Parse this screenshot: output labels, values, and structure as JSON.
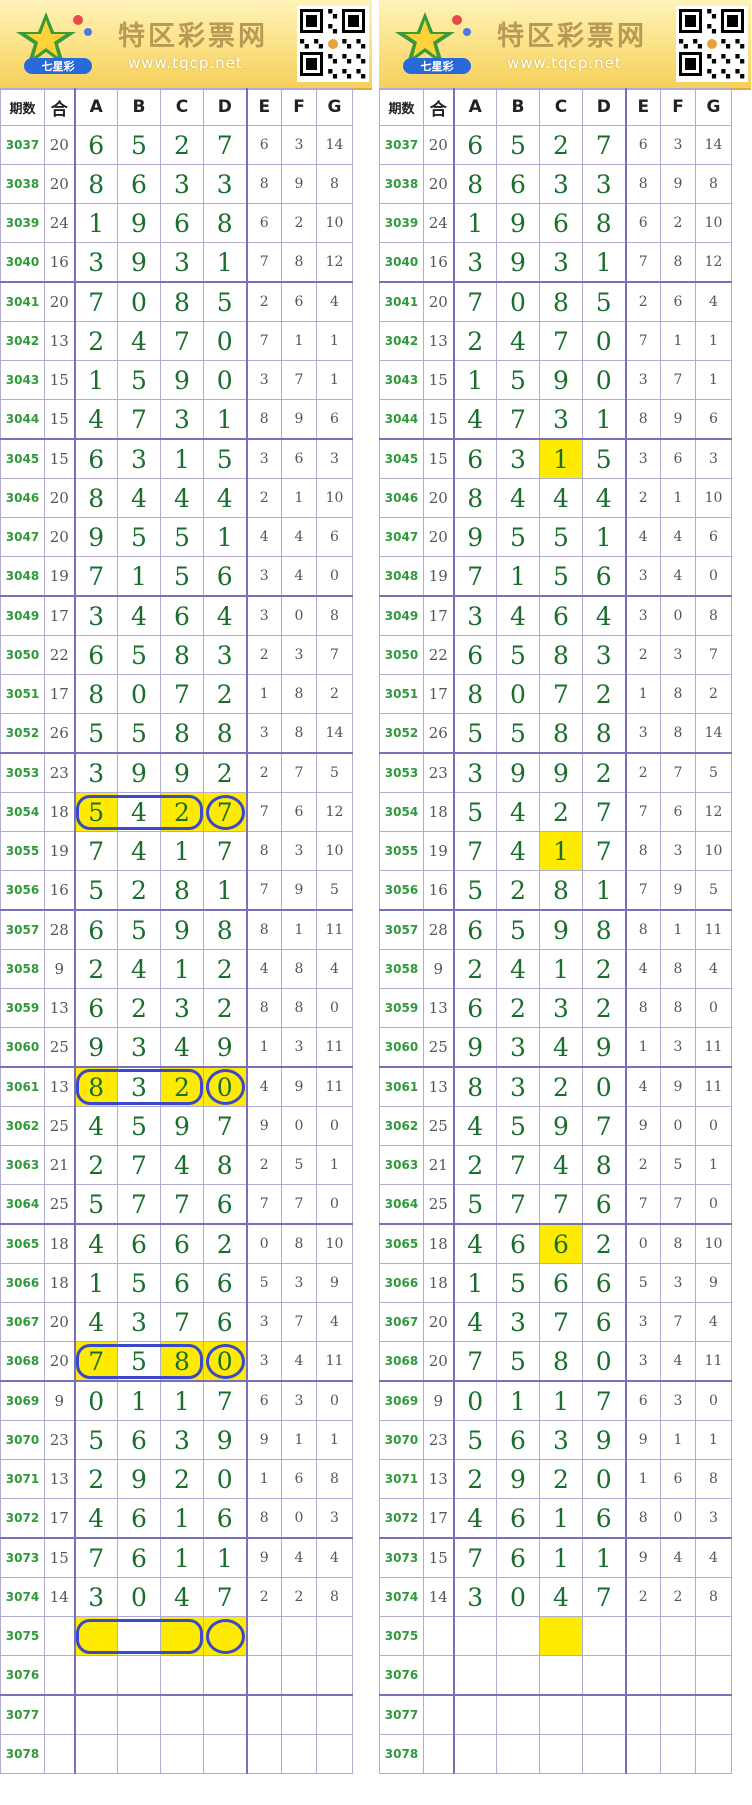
{
  "site": {
    "name": "特区彩票网",
    "url": "www.tqcp.net",
    "logo_text": "七星彩",
    "colors": {
      "header": "#f6cf5a",
      "digit": "#1a6e2c",
      "issue": "#2e9a3a",
      "highlight": "#ffeb00",
      "circle": "#3a48cc"
    }
  },
  "headers": [
    "期数",
    "合",
    "A",
    "B",
    "C",
    "D",
    "E",
    "F",
    "G"
  ],
  "rows": [
    {
      "q": "3037",
      "sum": "20",
      "a": "6",
      "b": "5",
      "c": "2",
      "d": "7",
      "e": "6",
      "f": "3",
      "g": "14"
    },
    {
      "q": "3038",
      "sum": "20",
      "a": "8",
      "b": "6",
      "c": "3",
      "d": "3",
      "e": "8",
      "f": "9",
      "g": "8"
    },
    {
      "q": "3039",
      "sum": "24",
      "a": "1",
      "b": "9",
      "c": "6",
      "d": "8",
      "e": "6",
      "f": "2",
      "g": "10"
    },
    {
      "q": "3040",
      "sum": "16",
      "a": "3",
      "b": "9",
      "c": "3",
      "d": "1",
      "e": "7",
      "f": "8",
      "g": "12"
    },
    {
      "q": "3041",
      "sum": "20",
      "a": "7",
      "b": "0",
      "c": "8",
      "d": "5",
      "e": "2",
      "f": "6",
      "g": "4"
    },
    {
      "q": "3042",
      "sum": "13",
      "a": "2",
      "b": "4",
      "c": "7",
      "d": "0",
      "e": "7",
      "f": "1",
      "g": "1"
    },
    {
      "q": "3043",
      "sum": "15",
      "a": "1",
      "b": "5",
      "c": "9",
      "d": "0",
      "e": "3",
      "f": "7",
      "g": "1"
    },
    {
      "q": "3044",
      "sum": "15",
      "a": "4",
      "b": "7",
      "c": "3",
      "d": "1",
      "e": "8",
      "f": "9",
      "g": "6"
    },
    {
      "q": "3045",
      "sum": "15",
      "a": "6",
      "b": "3",
      "c": "1",
      "d": "5",
      "e": "3",
      "f": "6",
      "g": "3"
    },
    {
      "q": "3046",
      "sum": "20",
      "a": "8",
      "b": "4",
      "c": "4",
      "d": "4",
      "e": "2",
      "f": "1",
      "g": "10"
    },
    {
      "q": "3047",
      "sum": "20",
      "a": "9",
      "b": "5",
      "c": "5",
      "d": "1",
      "e": "4",
      "f": "4",
      "g": "6"
    },
    {
      "q": "3048",
      "sum": "19",
      "a": "7",
      "b": "1",
      "c": "5",
      "d": "6",
      "e": "3",
      "f": "4",
      "g": "0"
    },
    {
      "q": "3049",
      "sum": "17",
      "a": "3",
      "b": "4",
      "c": "6",
      "d": "4",
      "e": "3",
      "f": "0",
      "g": "8"
    },
    {
      "q": "3050",
      "sum": "22",
      "a": "6",
      "b": "5",
      "c": "8",
      "d": "3",
      "e": "2",
      "f": "3",
      "g": "7"
    },
    {
      "q": "3051",
      "sum": "17",
      "a": "8",
      "b": "0",
      "c": "7",
      "d": "2",
      "e": "1",
      "f": "8",
      "g": "2"
    },
    {
      "q": "3052",
      "sum": "26",
      "a": "5",
      "b": "5",
      "c": "8",
      "d": "8",
      "e": "3",
      "f": "8",
      "g": "14"
    },
    {
      "q": "3053",
      "sum": "23",
      "a": "3",
      "b": "9",
      "c": "9",
      "d": "2",
      "e": "2",
      "f": "7",
      "g": "5"
    },
    {
      "q": "3054",
      "sum": "18",
      "a": "5",
      "b": "4",
      "c": "2",
      "d": "7",
      "e": "7",
      "f": "6",
      "g": "12"
    },
    {
      "q": "3055",
      "sum": "19",
      "a": "7",
      "b": "4",
      "c": "1",
      "d": "7",
      "e": "8",
      "f": "3",
      "g": "10"
    },
    {
      "q": "3056",
      "sum": "16",
      "a": "5",
      "b": "2",
      "c": "8",
      "d": "1",
      "e": "7",
      "f": "9",
      "g": "5"
    },
    {
      "q": "3057",
      "sum": "28",
      "a": "6",
      "b": "5",
      "c": "9",
      "d": "8",
      "e": "8",
      "f": "1",
      "g": "11"
    },
    {
      "q": "3058",
      "sum": "9",
      "a": "2",
      "b": "4",
      "c": "1",
      "d": "2",
      "e": "4",
      "f": "8",
      "g": "4"
    },
    {
      "q": "3059",
      "sum": "13",
      "a": "6",
      "b": "2",
      "c": "3",
      "d": "2",
      "e": "8",
      "f": "8",
      "g": "0"
    },
    {
      "q": "3060",
      "sum": "25",
      "a": "9",
      "b": "3",
      "c": "4",
      "d": "9",
      "e": "1",
      "f": "3",
      "g": "11"
    },
    {
      "q": "3061",
      "sum": "13",
      "a": "8",
      "b": "3",
      "c": "2",
      "d": "0",
      "e": "4",
      "f": "9",
      "g": "11"
    },
    {
      "q": "3062",
      "sum": "25",
      "a": "4",
      "b": "5",
      "c": "9",
      "d": "7",
      "e": "9",
      "f": "0",
      "g": "0"
    },
    {
      "q": "3063",
      "sum": "21",
      "a": "2",
      "b": "7",
      "c": "4",
      "d": "8",
      "e": "2",
      "f": "5",
      "g": "1"
    },
    {
      "q": "3064",
      "sum": "25",
      "a": "5",
      "b": "7",
      "c": "7",
      "d": "6",
      "e": "7",
      "f": "7",
      "g": "0"
    },
    {
      "q": "3065",
      "sum": "18",
      "a": "4",
      "b": "6",
      "c": "6",
      "d": "2",
      "e": "0",
      "f": "8",
      "g": "10"
    },
    {
      "q": "3066",
      "sum": "18",
      "a": "1",
      "b": "5",
      "c": "6",
      "d": "6",
      "e": "5",
      "f": "3",
      "g": "9"
    },
    {
      "q": "3067",
      "sum": "20",
      "a": "4",
      "b": "3",
      "c": "7",
      "d": "6",
      "e": "3",
      "f": "7",
      "g": "4"
    },
    {
      "q": "3068",
      "sum": "20",
      "a": "7",
      "b": "5",
      "c": "8",
      "d": "0",
      "e": "3",
      "f": "4",
      "g": "11"
    },
    {
      "q": "3069",
      "sum": "9",
      "a": "0",
      "b": "1",
      "c": "1",
      "d": "7",
      "e": "6",
      "f": "3",
      "g": "0"
    },
    {
      "q": "3070",
      "sum": "23",
      "a": "5",
      "b": "6",
      "c": "3",
      "d": "9",
      "e": "9",
      "f": "1",
      "g": "1"
    },
    {
      "q": "3071",
      "sum": "13",
      "a": "2",
      "b": "9",
      "c": "2",
      "d": "0",
      "e": "1",
      "f": "6",
      "g": "8"
    },
    {
      "q": "3072",
      "sum": "17",
      "a": "4",
      "b": "6",
      "c": "1",
      "d": "6",
      "e": "8",
      "f": "0",
      "g": "3"
    },
    {
      "q": "3073",
      "sum": "15",
      "a": "7",
      "b": "6",
      "c": "1",
      "d": "1",
      "e": "9",
      "f": "4",
      "g": "4"
    },
    {
      "q": "3074",
      "sum": "14",
      "a": "3",
      "b": "0",
      "c": "4",
      "d": "7",
      "e": "2",
      "f": "2",
      "g": "8"
    },
    {
      "q": "3075",
      "sum": "",
      "a": "",
      "b": "",
      "c": "",
      "d": "",
      "e": "",
      "f": "",
      "g": ""
    },
    {
      "q": "3076",
      "sum": "",
      "a": "",
      "b": "",
      "c": "",
      "d": "",
      "e": "",
      "f": "",
      "g": ""
    },
    {
      "q": "3077",
      "sum": "",
      "a": "",
      "b": "",
      "c": "",
      "d": "",
      "e": "",
      "f": "",
      "g": ""
    },
    {
      "q": "3078",
      "sum": "",
      "a": "",
      "b": "",
      "c": "",
      "d": "",
      "e": "",
      "f": "",
      "g": ""
    }
  ],
  "left_highlights": [
    {
      "row": 17,
      "cols": [
        "a",
        "c",
        "d"
      ],
      "circled": true
    },
    {
      "row": 24,
      "cols": [
        "a",
        "c",
        "d"
      ],
      "circled": true
    },
    {
      "row": 31,
      "cols": [
        "a",
        "c",
        "d"
      ],
      "circled": true
    },
    {
      "row": 38,
      "cols": [
        "a",
        "c",
        "d"
      ],
      "circled": true
    }
  ],
  "right_highlights": [
    {
      "row": 8,
      "cols": [
        "c"
      ]
    },
    {
      "row": 18,
      "cols": [
        "c"
      ]
    },
    {
      "row": 28,
      "cols": [
        "c"
      ]
    },
    {
      "row": 38,
      "cols": [
        "c"
      ]
    }
  ]
}
